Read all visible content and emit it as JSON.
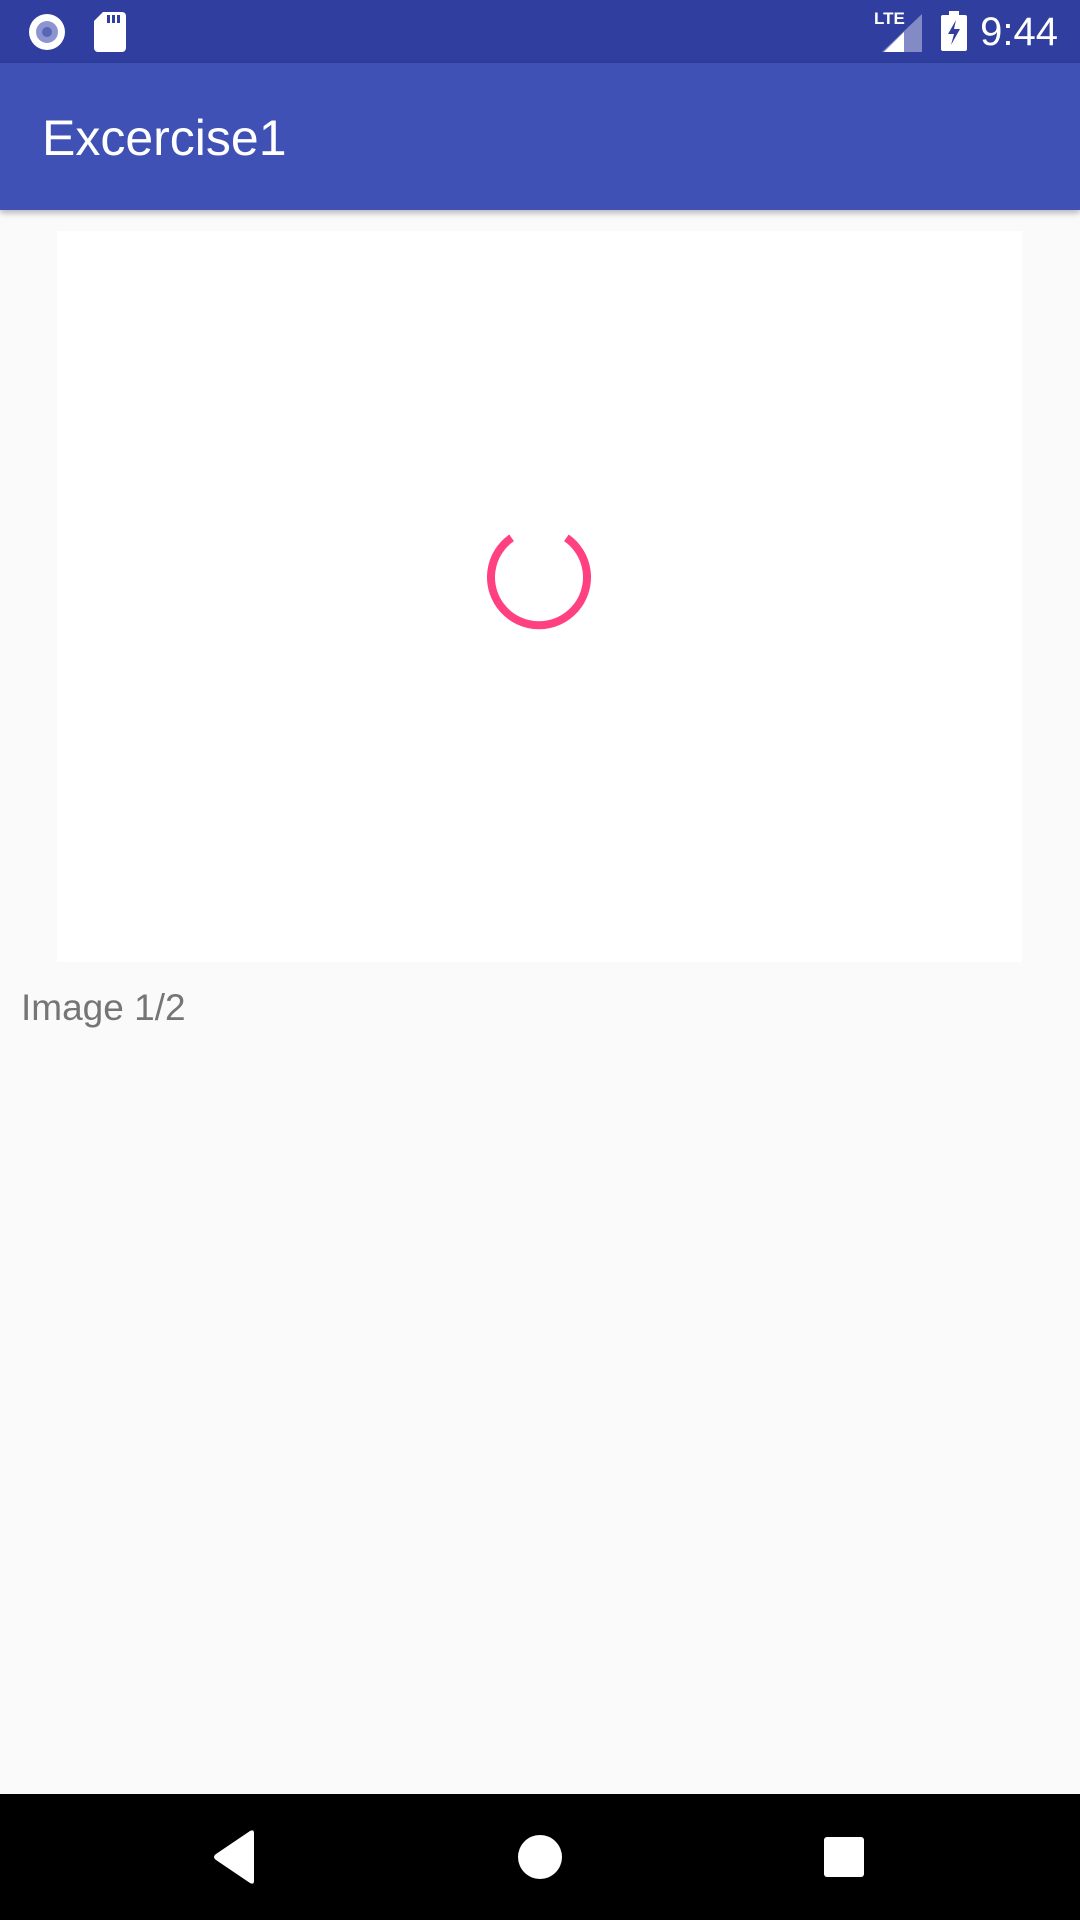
{
  "status_bar": {
    "time": "9:44",
    "network_label": "LTE",
    "icons": [
      "radio-icon",
      "sd-card-icon",
      "lte-signal-icon",
      "battery-charging-icon"
    ]
  },
  "app_bar": {
    "title": "Excercise1"
  },
  "content": {
    "loading_indicator": "spinner-icon",
    "caption": "Image 1/2"
  },
  "nav_bar": {
    "buttons": [
      "back-icon",
      "home-icon",
      "recents-icon"
    ]
  },
  "colors": {
    "status_bar": "#303f9f",
    "app_bar": "#3f51b5",
    "accent": "#ff4081",
    "background": "#fafafa",
    "card": "#ffffff",
    "caption_text": "#757575"
  }
}
